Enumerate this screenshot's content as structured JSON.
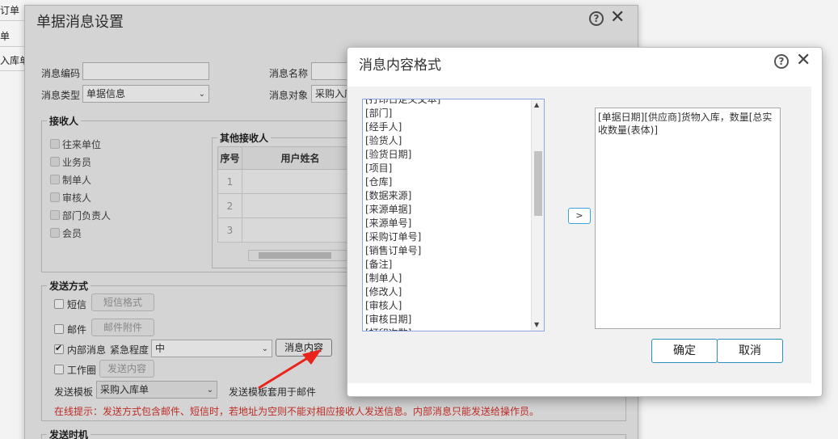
{
  "background": {
    "rows": [
      "订单",
      "单",
      "入库单"
    ]
  },
  "main_dialog": {
    "title": "单据消息设置",
    "help_icon": "help-circle-icon",
    "close_icon": "close-icon",
    "fields": {
      "msg_code_label": "消息编码",
      "msg_name_label": "消息名称",
      "msg_type_label": "消息类型",
      "msg_type_value": "单据信息",
      "msg_target_label": "消息对象",
      "msg_target_value": "采购入库"
    },
    "recipients": {
      "legend": "接收人",
      "options": [
        "往来单位",
        "业务员",
        "制单人",
        "审核人",
        "部门负责人",
        "会员"
      ],
      "other_legend": "其他接收人",
      "table_headers": [
        "序号",
        "用户姓名"
      ],
      "table_rows": [
        "1",
        "2",
        "3"
      ]
    },
    "send_method": {
      "legend": "发送方式",
      "sms_label": "短信",
      "sms_format_button": "短信格式",
      "email_label": "邮件",
      "email_attach_button": "邮件附件",
      "internal_label": "内部消息",
      "urgency_label": "紧急程度",
      "urgency_value": "中",
      "msg_content_button": "消息内容",
      "workspace_label": "工作圈",
      "send_content_button": "发送内容",
      "template_label": "发送模板",
      "template_value": "采购入库单",
      "template_note": "发送模板套用于邮件",
      "hint": "在线提示：发送方式包含邮件、短信时，若地址为空则不能对相应接收人发送信息。内部消息只能发送给操作员。"
    },
    "send_time_legend": "发送时机"
  },
  "content_dialog": {
    "title": "消息内容格式",
    "help_icon": "help-circle-icon",
    "close_icon": "close-icon",
    "field_list": [
      "[打印日定义文本]",
      "[部门]",
      "[经手人]",
      "[验货人]",
      "[验货日期]",
      "[项目]",
      "[仓库]",
      "[数据来源]",
      "[来源单据]",
      "[来源单号]",
      "[采购订单号]",
      "[销售订单号]",
      "[备注]",
      "[制单人]",
      "[修改人]",
      "[审核人]",
      "[审核日期]",
      "[打印次数]"
    ],
    "insert_button": ">",
    "content": "[单据日期][供应商]货物入库，数量[总实收数量(表体)]",
    "ok_button": "确定",
    "cancel_button": "取消"
  },
  "colors": {
    "accent": "#2c8fc0",
    "hint_red": "#d9322b",
    "arrow_red": "#e8241b"
  }
}
